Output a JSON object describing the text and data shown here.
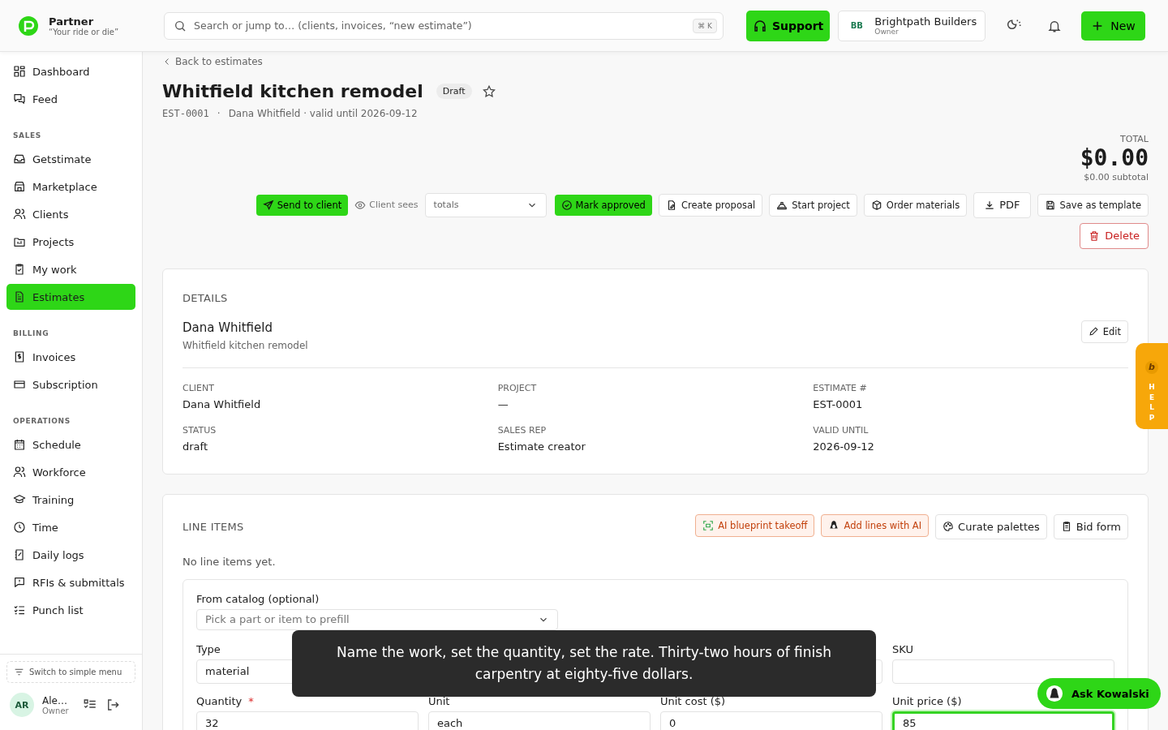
{
  "brand": {
    "name": "Partner",
    "tagline": "“Your ride or die”"
  },
  "search": {
    "placeholder": "Search or jump to… (clients, invoices, “new estimate”)",
    "shortcut": "⌘ K"
  },
  "header": {
    "support": "Support",
    "org": {
      "initials": "BB",
      "name": "Brightpath Builders",
      "role": "Owner"
    },
    "new": "New"
  },
  "sidebar": {
    "sections": [
      {
        "items": [
          {
            "label": "Dashboard",
            "selected": false
          },
          {
            "label": "Feed",
            "selected": false
          }
        ]
      },
      {
        "title": "SALES",
        "items": [
          {
            "label": "Getstimate",
            "selected": false
          },
          {
            "label": "Marketplace",
            "selected": false
          },
          {
            "label": "Clients",
            "selected": false
          },
          {
            "label": "Projects",
            "selected": false
          },
          {
            "label": "My work",
            "selected": false
          },
          {
            "label": "Estimates",
            "selected": true
          }
        ]
      },
      {
        "title": "BILLING",
        "items": [
          {
            "label": "Invoices",
            "selected": false
          },
          {
            "label": "Subscription",
            "selected": false
          }
        ]
      },
      {
        "title": "OPERATIONS",
        "items": [
          {
            "label": "Schedule",
            "selected": false
          },
          {
            "label": "Workforce",
            "selected": false
          },
          {
            "label": "Training",
            "selected": false
          },
          {
            "label": "Time",
            "selected": false
          },
          {
            "label": "Daily logs",
            "selected": false
          },
          {
            "label": "RFIs & submittals",
            "selected": false
          },
          {
            "label": "Punch list",
            "selected": false
          }
        ]
      }
    ],
    "switch": "Switch to simple menu",
    "user": {
      "initials": "AR",
      "name": "Ale…",
      "role": "Owner"
    }
  },
  "back": "Back to estimates",
  "estimate": {
    "title": "Whitfield kitchen remodel",
    "status": "Draft",
    "starred": false,
    "number": "EST-0001",
    "sep": "·",
    "meta": "Dana Whitfield · valid until 2026-09-12",
    "total_label": "TOTAL",
    "total": "$0.00",
    "subtotal": "$0.00 subtotal"
  },
  "actions": {
    "send": "Send to client",
    "client_sees_label": "Client sees",
    "client_sees": "totals",
    "approve": "Mark approved",
    "buttons": [
      "Create proposal",
      "Start project",
      "Order materials",
      "PDF",
      "Save as template"
    ],
    "delete": "Delete"
  },
  "details": {
    "title": "DETAILS",
    "name": "Dana Whitfield",
    "subtitle": "Whitfield kitchen remodel",
    "edit": "Edit",
    "fields": [
      {
        "label": "CLIENT",
        "value": "Dana Whitfield"
      },
      {
        "label": "PROJECT",
        "value": "—"
      },
      {
        "label": "ESTIMATE #",
        "value": "EST-0001"
      },
      {
        "label": "STATUS",
        "value": "draft"
      },
      {
        "label": "SALES REP",
        "value": "Estimate creator"
      },
      {
        "label": "VALID UNTIL",
        "value": "2026-09-12"
      }
    ]
  },
  "line_items": {
    "title": "LINE ITEMS",
    "buttons": [
      {
        "label": "AI blueprint takeoff",
        "kind": "ai"
      },
      {
        "label": "Add lines with AI",
        "kind": "ai"
      },
      {
        "label": "Curate palettes",
        "kind": "plain"
      },
      {
        "label": "Bid form",
        "kind": "plain"
      }
    ],
    "empty": "No line items yet.",
    "form": {
      "catalog_label": "From catalog (optional)",
      "catalog_placeholder": "Pick a part or item to prefill",
      "type_label": "Type",
      "type_value": "material",
      "sku_label": "SKU",
      "required_mark": "*",
      "fields": [
        {
          "label": "Quantity",
          "required": true,
          "value": "32",
          "focused": false
        },
        {
          "label": "Unit",
          "required": false,
          "value": "each",
          "focused": false
        },
        {
          "label": "Unit cost ($)",
          "required": false,
          "value": "0",
          "focused": false
        },
        {
          "label": "Unit price ($)",
          "required": false,
          "value": "85",
          "focused": true
        }
      ]
    }
  },
  "help": {
    "glyph": "b",
    "label": "HELP"
  },
  "caption": "Name the work, set the quantity, set the rate. Thirty-two hours of finish carpentry at eighty-five dollars.",
  "assistant": "Ask Kowalski"
}
